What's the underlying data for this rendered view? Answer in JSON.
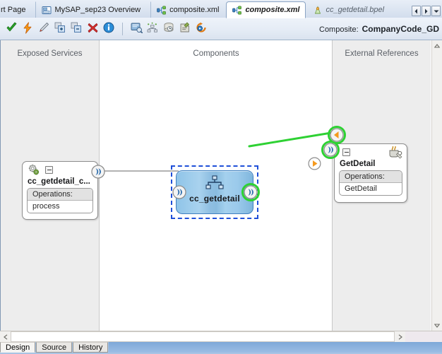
{
  "window": {
    "composite_prefix": "Composite:",
    "composite_name": "CompanyCode_GD"
  },
  "tabs": [
    {
      "label": "rt Page",
      "icon": "none",
      "state": "clipped"
    },
    {
      "label": "MySAP_sep23 Overview",
      "icon": "overview-icon",
      "state": "inactive"
    },
    {
      "label": "composite.xml",
      "icon": "composite-icon",
      "state": "inactive"
    },
    {
      "label": "composite.xml",
      "icon": "composite-icon",
      "state": "active"
    },
    {
      "label": "cc_getdetail.bpel",
      "icon": "bpel-icon",
      "state": "inactive"
    }
  ],
  "tab_nav": [
    {
      "name": "previous-tab-button",
      "glyph": "left-triangle-icon"
    },
    {
      "name": "next-tab-button",
      "glyph": "right-triangle-icon"
    },
    {
      "name": "tab-list-button",
      "glyph": "chevron-down-icon"
    }
  ],
  "toolbar": {
    "buttons": [
      {
        "name": "validate-button",
        "icon": "green-check-icon",
        "title": "Validate"
      },
      {
        "name": "deploy-button",
        "icon": "lightning-bolt-icon",
        "title": "Deploy"
      },
      {
        "name": "edit-button",
        "icon": "pencil-icon",
        "title": "Edit"
      },
      {
        "name": "add-button",
        "icon": "add-box-icon",
        "title": "Add"
      },
      {
        "name": "remove-button",
        "icon": "remove-box-icon",
        "title": "Remove"
      },
      {
        "name": "delete-button",
        "icon": "red-x-icon",
        "title": "Delete"
      },
      {
        "name": "info-button",
        "icon": "info-circle-icon",
        "title": "Info"
      },
      {
        "name": "separator",
        "icon": "separator",
        "title": ""
      },
      {
        "name": "properties-button",
        "icon": "properties-icon",
        "title": "Properties"
      },
      {
        "name": "expand-all-button",
        "icon": "tree-expand-icon",
        "title": "Expand All"
      },
      {
        "name": "history-button",
        "icon": "clock-disk-icon",
        "title": "History"
      },
      {
        "name": "policy-button",
        "icon": "policy-icon",
        "title": "Policies"
      },
      {
        "name": "refresh-button",
        "icon": "refresh-icon",
        "title": "Refresh"
      }
    ]
  },
  "canvas": {
    "lanes": [
      {
        "name": "exposed-services",
        "title": "Exposed Services"
      },
      {
        "name": "components",
        "title": "Components"
      },
      {
        "name": "external-references",
        "title": "External References"
      }
    ],
    "exposed_service": {
      "title": "cc_getdetail_c...",
      "operations_label": "Operations:",
      "operations": [
        "process"
      ],
      "collapse_glyph": "minus",
      "icon": "web-service-gears-icon",
      "port": "exposed-service-port"
    },
    "component": {
      "label": "cc_getdetail",
      "selected": true,
      "icon": "bpel-process-icon",
      "input_port": "component-input-port",
      "output_port": "component-output-port",
      "output_port_highlighted": true
    },
    "external_reference": {
      "title": "GetDetail",
      "operations_label": "Operations:",
      "operations": [
        "GetDetail"
      ],
      "collapse_glyph": "minus",
      "icon": "adapter-coffee-icon",
      "in_port": "reference-callback-port",
      "out_port": "reference-input-port",
      "ports_highlighted": true
    },
    "wires": [
      {
        "name": "wire-service-to-component",
        "color": "#9a9a9a",
        "highlighted": false
      },
      {
        "name": "wire-component-to-reference",
        "color": "#2ed133",
        "highlighted": true,
        "marker": "orange-arrow"
      }
    ]
  },
  "bottom_tabs": [
    {
      "label": "Design",
      "active": true
    },
    {
      "label": "Source",
      "active": false
    },
    {
      "label": "History",
      "active": false
    }
  ],
  "colors": {
    "selection_blue": "#1f4fd8",
    "highlight_green": "#2ed133",
    "wire_gray": "#9a9a9a",
    "marker_orange": "#f59a1e",
    "lane_gray": "#ededed",
    "status_blue": "#a8c4e4"
  }
}
